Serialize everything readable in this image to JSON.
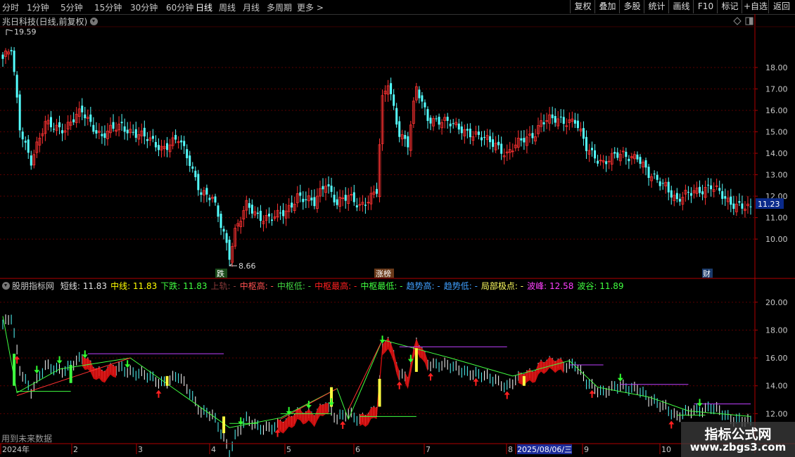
{
  "toolbar": {
    "timeframes": [
      "分时",
      "1分钟",
      "5分钟",
      "15分钟",
      "30分钟",
      "60分钟",
      "日线",
      "周线",
      "月线",
      "多周期",
      "更多 >"
    ],
    "active_timeframe": "日线",
    "buttons": [
      "复权",
      "叠加",
      "多股",
      "统计",
      "画线",
      "F10",
      "标记",
      "+自选",
      "返回"
    ]
  },
  "main_panel": {
    "title": "兆日科技(日线,前复权)",
    "current_price_label": "11.23",
    "high_label": "19.59",
    "low_label": "8.66",
    "markers": [
      "跌",
      "涨榜",
      "财"
    ]
  },
  "indicator_panel": {
    "name": "股朋指标网",
    "legend": [
      {
        "label": "短线:",
        "value": "11.83",
        "color": "#e0e0e0"
      },
      {
        "label": "中线:",
        "value": "11.83",
        "color": "#ffff00"
      },
      {
        "label": "下跌:",
        "value": "11.83",
        "color": "#40ff40"
      },
      {
        "label": "上轨:",
        "value": "-",
        "color": "#8b3a3a"
      },
      {
        "label": "中枢高:",
        "value": "-",
        "color": "#ff5050"
      },
      {
        "label": "中枢低:",
        "value": "-",
        "color": "#40d040"
      },
      {
        "label": "中枢最高:",
        "value": "-",
        "color": "#ff2020"
      },
      {
        "label": "中枢最低:",
        "value": "-",
        "color": "#40ff40"
      },
      {
        "label": "趋势高:",
        "value": "-",
        "color": "#40a0ff"
      },
      {
        "label": "趋势低:",
        "value": "-",
        "color": "#40a0ff"
      },
      {
        "label": "局部极点:",
        "value": "-",
        "color": "#ffff60"
      },
      {
        "label": "波峰:",
        "value": "12.58",
        "color": "#ff40ff"
      },
      {
        "label": "波谷:",
        "value": "11.89",
        "color": "#40ff40"
      }
    ],
    "note": "用到未来数据"
  },
  "x_axis": {
    "labels": [
      "2024年",
      "2",
      "3",
      "4",
      "5",
      "6",
      "7",
      "8",
      "2025/08/06/三",
      "9",
      "10"
    ]
  },
  "watermark": {
    "line1": "指标公式网",
    "line2": "www.zbgs3.com"
  },
  "colors": {
    "up": "#ff3232",
    "down": "#54ffff",
    "axis": "#b00000",
    "text": "#c8c8c8"
  },
  "chart_data": [
    {
      "type": "candlestick",
      "title": "兆日科技(日线,前复权)",
      "y_axis_ticks": [
        10.0,
        11.0,
        12.0,
        13.0,
        14.0,
        15.0,
        16.0,
        17.0,
        18.0
      ],
      "ylim": [
        8.2,
        19.9
      ],
      "last_price": 11.23,
      "annotations": [
        {
          "text": "19.59",
          "value": 19.59
        },
        {
          "text": "8.66",
          "value": 8.66
        }
      ],
      "close_path": [
        [
          0,
          18.4
        ],
        [
          3,
          18.8
        ],
        [
          6,
          15.2
        ],
        [
          10,
          13.7
        ],
        [
          15,
          15.3
        ],
        [
          22,
          15.2
        ],
        [
          28,
          15.9
        ],
        [
          35,
          14.8
        ],
        [
          42,
          15.3
        ],
        [
          50,
          14.7
        ],
        [
          56,
          14.3
        ],
        [
          62,
          14.6
        ],
        [
          66,
          13.6
        ],
        [
          70,
          12.2
        ],
        [
          74,
          11.8
        ],
        [
          78,
          10.3
        ],
        [
          80,
          9.3
        ],
        [
          82,
          10.4
        ],
        [
          86,
          11.5
        ],
        [
          90,
          11.1
        ],
        [
          96,
          11.0
        ],
        [
          100,
          11.2
        ],
        [
          104,
          12.1
        ],
        [
          110,
          11.6
        ],
        [
          114,
          12.7
        ],
        [
          118,
          11.7
        ],
        [
          122,
          11.9
        ],
        [
          126,
          11.6
        ],
        [
          132,
          12.2
        ],
        [
          134,
          16.4
        ],
        [
          136,
          17.3
        ],
        [
          140,
          15.0
        ],
        [
          143,
          14.4
        ],
        [
          146,
          17.0
        ],
        [
          150,
          15.7
        ],
        [
          156,
          15.4
        ],
        [
          162,
          15.2
        ],
        [
          168,
          14.7
        ],
        [
          174,
          14.5
        ],
        [
          178,
          13.9
        ],
        [
          184,
          14.7
        ],
        [
          188,
          15.0
        ],
        [
          190,
          15.4
        ],
        [
          196,
          15.6
        ],
        [
          202,
          15.5
        ],
        [
          206,
          14.2
        ],
        [
          212,
          13.6
        ],
        [
          218,
          13.9
        ],
        [
          224,
          13.9
        ],
        [
          228,
          12.9
        ],
        [
          234,
          12.6
        ],
        [
          238,
          11.7
        ],
        [
          244,
          12.3
        ],
        [
          250,
          12.4
        ],
        [
          256,
          11.8
        ],
        [
          260,
          11.6
        ],
        [
          264,
          11.3
        ]
      ]
    },
    {
      "type": "line",
      "title": "股朋指标网",
      "y_axis_ticks": [
        12.0,
        14.0,
        16.0,
        18.0,
        20.0
      ],
      "ylim": [
        10.0,
        21.0
      ],
      "x_tick_labels": [
        "2024年",
        "2",
        "3",
        "4",
        "5",
        "6",
        "7",
        "8",
        "2025/08/06/三",
        "9",
        "10"
      ]
    }
  ]
}
